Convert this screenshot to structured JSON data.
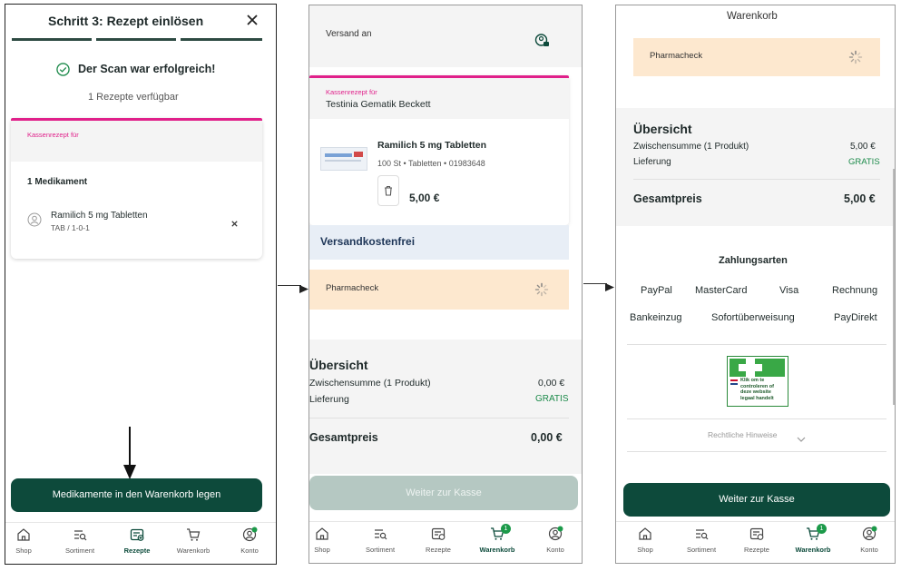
{
  "nav": {
    "shop": "Shop",
    "sortiment": "Sortiment",
    "rezepte": "Rezepte",
    "warenkorb": "Warenkorb",
    "konto": "Konto",
    "cart_count": "1"
  },
  "screen1": {
    "header_title": "Schritt 3: Rezept einlösen",
    "success": "Der Scan war erfolgreich!",
    "available": "1 Rezepte verfügbar",
    "kassenrezept_label": "Kassenrezept für",
    "med_count": "1 Medikament",
    "med_name": "Ramilich 5 mg Tabletten",
    "med_dosage": "TAB / 1-0-1",
    "add_button": "Medikamente in den Warenkorb legen"
  },
  "screen2": {
    "versand_label": "Versand an",
    "kassenrezept_label": "Kassenrezept für",
    "patient_name": "Testinia Gematik Beckett",
    "product_name": "Ramilich 5 mg Tabletten",
    "product_meta": "100 St  •  Tabletten  •  01983648",
    "price": "5,00 €",
    "shipping_free": "Versandkostenfrei",
    "pharmacheck": "Pharmacheck",
    "overview_title": "Übersicht",
    "subtotal_label": "Zwischensumme (1 Produkt)",
    "subtotal_value": "0,00 €",
    "delivery_label": "Lieferung",
    "delivery_value": "GRATIS",
    "total_label": "Gesamtpreis",
    "total_value": "0,00 €",
    "checkout_button": "Weiter zur Kasse"
  },
  "screen3": {
    "header_title": "Warenkorb",
    "pharmacheck": "Pharmacheck",
    "overview_title": "Übersicht",
    "subtotal_label": "Zwischensumme (1 Produkt)",
    "subtotal_value": "5,00 €",
    "delivery_label": "Lieferung",
    "delivery_value": "GRATIS",
    "total_label": "Gesamtpreis",
    "total_value": "5,00 €",
    "payment_title": "Zahlungsarten",
    "payments_row1": [
      "PayPal",
      "MasterCard",
      "Visa",
      "Rechnung"
    ],
    "payments_row2": [
      "Bankeinzug",
      "Sofortüberweisung",
      "PayDirekt"
    ],
    "badge_text": "Klik om te controleren of deze website legaal handelt",
    "legal": "Rechtliche Hinweise",
    "checkout_button": "Weiter zur Kasse"
  },
  "colors": {
    "primary": "#0d4a3b",
    "accent_magenta": "#e0208a",
    "peach": "#fde8cf",
    "free_green": "#1c8a4a",
    "shipping_bg": "#e8eef6",
    "shipping_text": "#1d3557"
  }
}
